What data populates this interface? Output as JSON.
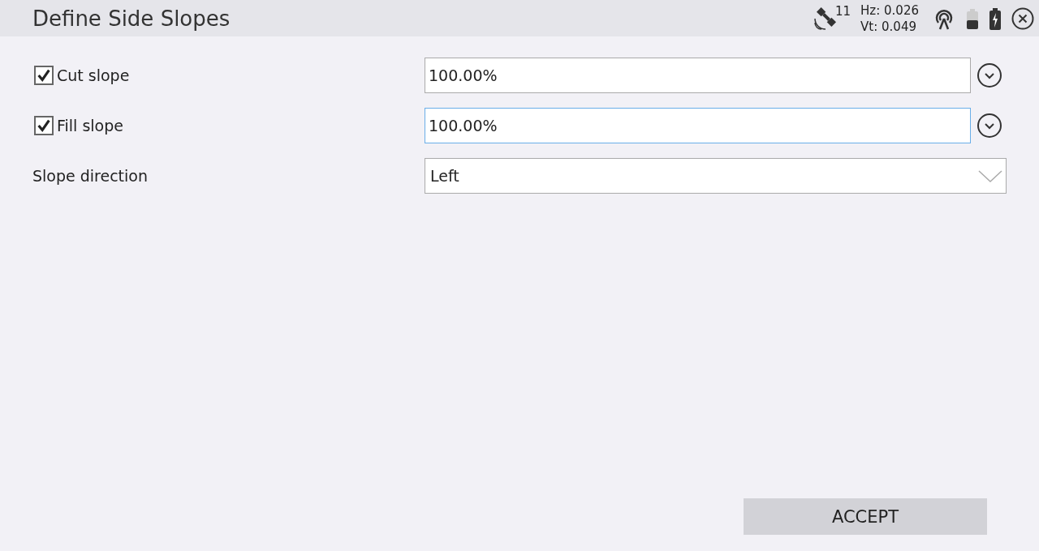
{
  "window": {
    "title": "Define Side Slopes"
  },
  "status": {
    "satellites": "11",
    "hz": "Hz: 0.026",
    "vt": "Vt: 0.049"
  },
  "rows": [
    {
      "kind": "checkbox",
      "label": "Cut slope",
      "checked": true,
      "value": "100.00%",
      "focused": false
    },
    {
      "kind": "checkbox",
      "label": "Fill slope",
      "checked": true,
      "value": "100.00%",
      "focused": true
    },
    {
      "kind": "select",
      "label": "Slope direction",
      "value": "Left"
    }
  ],
  "buttons": [
    {
      "label": "ACCEPT"
    }
  ]
}
